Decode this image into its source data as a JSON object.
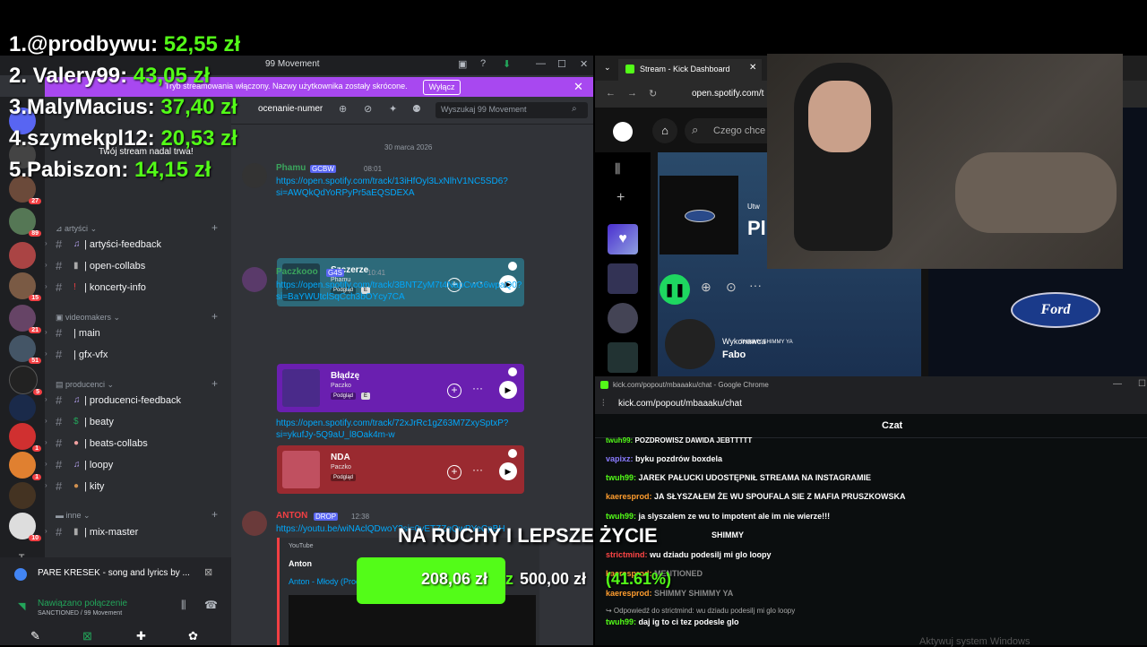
{
  "leaderboard": [
    {
      "rank_name": "1.@prodbywu:",
      "amount": "52,55 zł"
    },
    {
      "rank_name": "2. Valery99:",
      "amount": "43,05 zł"
    },
    {
      "rank_name": "3.MalyMacius:",
      "amount": "37,40 zł"
    },
    {
      "rank_name": "4.szymekpl12:",
      "amount": "20,53 zł"
    },
    {
      "rank_name": "5.Pabiszon:",
      "amount": "14,15 zł"
    }
  ],
  "discord": {
    "window_title": "99 Movement",
    "stream_banner": "Tryb streamowania włączony. Nazwy użytkownika zostały skrócone.",
    "stream_banner_button": "Wyłącz",
    "stream_notice": "Twój stream nadal trwa!",
    "channel_header": "ocenanie-numer",
    "search_placeholder": "Wyszukaj 99 Movement",
    "date_divider": "30 marca 2026",
    "server_badges": [
      "27",
      "89",
      "15",
      "21",
      "51",
      "5",
      "1",
      "1",
      "10"
    ],
    "categories": [
      {
        "name": "artyści",
        "channels": [
          {
            "icon": "♫",
            "name": "artyści-feedback"
          },
          {
            "icon": "▮",
            "name": "open-collabs"
          },
          {
            "icon": "!",
            "name": "koncerty-info"
          }
        ]
      },
      {
        "name": "videomakers",
        "channels": [
          {
            "icon": "",
            "name": "main"
          },
          {
            "icon": "",
            "name": "gfx-vfx"
          }
        ]
      },
      {
        "name": "producenci",
        "channels": [
          {
            "icon": "♫",
            "name": "producenci-feedback"
          },
          {
            "icon": "$",
            "name": "beaty"
          },
          {
            "icon": "●",
            "name": "beats-collabs"
          },
          {
            "icon": "♫",
            "name": "loopy"
          },
          {
            "icon": "●",
            "name": "kity"
          }
        ]
      },
      {
        "name": "inne",
        "channels": [
          {
            "icon": "▮",
            "name": "mix-master"
          }
        ]
      }
    ],
    "activity": "PARE KRESEK - song and lyrics by ...",
    "voice": {
      "status": "Nawiązano połączenie",
      "sub": "SANCTIONED / 99 Movement"
    },
    "messages": [
      {
        "author": "Phamu",
        "tag": "GCBW",
        "time": "08:01",
        "link": "https://open.spotify.com/track/13iHfOyl3LxNlhV1NC5SD6?si=AWQkQdYoRPyPr5aEQSDEXA",
        "embed": {
          "title": "Szczerze",
          "artist": "Phamu",
          "preview": "Podgląd",
          "explicit": "E"
        }
      },
      {
        "author": "Paczkooo",
        "tag": "G4S",
        "time": "10:41",
        "link": "https://open.spotify.com/track/3BNTZyM7t4NapCwG6wpaQ0?si=BaYWUtclSqCch3bOYcy7CA",
        "embed": {
          "title": "Błądzę",
          "artist": "Paczko",
          "preview": "Podgląd",
          "explicit": "E"
        }
      },
      {
        "link": "https://open.spotify.com/track/72xJrRc1gZ63M7ZxySptxP?si=ykufJy-5Q9aU_l8Oak4m-w",
        "embed": {
          "title": "NDA",
          "artist": "Paczko",
          "preview": "Podgląd"
        }
      },
      {
        "author": "ANTON",
        "tag": "DROP",
        "time": "12:38",
        "link": "https://youtu.be/wiNAclQDwoY?si=0vETZZgQwPYeCpBH",
        "yt": {
          "site": "YouTube",
          "channel": "Anton",
          "title": "Anton - Młody (Prod.Made...) [Official Audio]"
        }
      }
    ]
  },
  "kick": {
    "tab_title": "Stream - Kick Dashboard",
    "url": "open.spotify.com/t",
    "spotify_search": "Czego chce",
    "performer_label": "Wykonawca",
    "performer_overlay": "SHIMMY SHIMMY YA",
    "artist": "Fabo",
    "title_partial": "Pl",
    "utw": "Utw"
  },
  "chat_window": {
    "title": "kick.com/popout/mbaaaku/chat - Google Chrome",
    "url": "kick.com/popout/mbaaaku/chat",
    "header": "Czat",
    "messages": [
      {
        "user": "twuh99:",
        "text": " POZDROWISZ DAWIDA JEBTTTTT"
      },
      {
        "user": "vapixz:",
        "text": " byku pozdrów boxdela"
      },
      {
        "user": "twuh99:",
        "text": " JAREK PAŁUCKI UDOSTĘPNIŁ STREAMA NA INSTAGRAMIE"
      },
      {
        "user": "kaeresprod:",
        "text": " JA SŁYSZAŁEM ŻE WU SPOUFALA SIE Z MAFIA PRUSZKOWSKA"
      },
      {
        "user": "twuh99:",
        "text": " ja slyszalem ze wu to impotent ale im nie wierze!!!"
      },
      {
        "user": "",
        "text": "SHIMMY"
      },
      {
        "user": "strictmind:",
        "text": " wu dziadu podesilj mi glo loopy"
      },
      {
        "user": "kaeresprod:",
        "text": " MENTIONED"
      },
      {
        "user": "kaeresprod:",
        "text": " SHIMMY SHIMMY YA"
      },
      {
        "user": "",
        "text": "↪ Odpowiedź do strictmind: wu dziadu podesilj mi glo loopy"
      },
      {
        "user": "twuh99:",
        "text": " daj ig to ci tez podesle glo"
      }
    ],
    "watermark": "Aktywuj system Windows"
  },
  "goal": {
    "caption": "NA RUCHY I LEPSZE ŻYCIE",
    "current": "208,06 zł",
    "separator": "z",
    "target": "500,00 zł",
    "percent_text": "(41.61%)",
    "fraction": 0.4161
  },
  "colors": {
    "kick_green": "#53fc18",
    "discord_purple": "#a848f0",
    "spotify_green": "#1ed760"
  }
}
